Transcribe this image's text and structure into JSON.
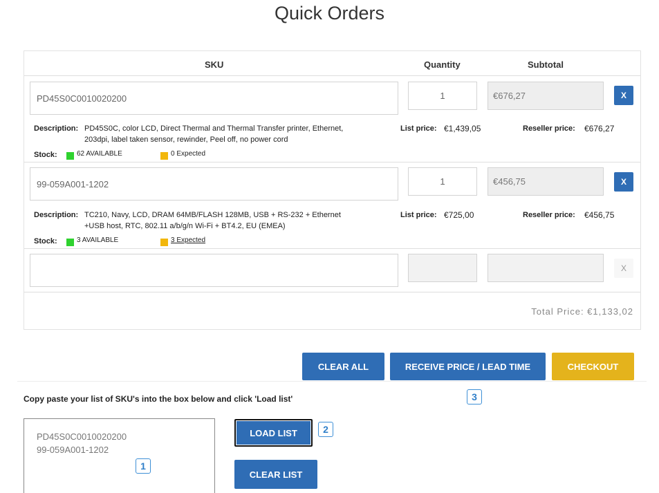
{
  "page": {
    "title": "Quick Orders"
  },
  "table": {
    "headers": {
      "sku": "SKU",
      "quantity": "Quantity",
      "subtotal": "Subtotal"
    },
    "rows": [
      {
        "sku": "PD45S0C0010020200",
        "quantity": "1",
        "subtotal": "€676,27",
        "remove": "X",
        "description_label": "Description:",
        "description_line1": "PD45S0C, color LCD, Direct Thermal and Thermal Transfer printer, Ethernet,",
        "description_line2": "203dpi, label taken sensor, rewinder, Peel off, no power cord",
        "list_price_label": "List price:",
        "list_price": "€1,439,05",
        "reseller_price_label": "Reseller price:",
        "reseller_price": "€676,27",
        "stock_label": "Stock:",
        "available": "62 AVAILABLE",
        "expected": "0 Expected"
      },
      {
        "sku": "99-059A001-1202",
        "quantity": "1",
        "subtotal": "€456,75",
        "remove": "X",
        "description_label": "Description:",
        "description_line1": "TC210, Navy, LCD, DRAM 64MB/FLASH 128MB, USB + RS-232 + Ethernet",
        "description_line2": "+USB host, RTC, 802.11 a/b/g/n Wi-Fi + BT4.2, EU (EMEA)",
        "list_price_label": "List price:",
        "list_price": "€725,00",
        "reseller_price_label": "Reseller price:",
        "reseller_price": "€456,75",
        "stock_label": "Stock:",
        "available": "3 AVAILABLE",
        "expected": "3 Expected"
      }
    ],
    "empty_row": {
      "sku": "",
      "quantity": "",
      "subtotal": "",
      "remove": "X"
    },
    "total": "Total Price: €1,133,02"
  },
  "actions": {
    "clear_all": "CLEAR ALL",
    "receive_price": "RECEIVE PRICE / LEAD TIME",
    "checkout": "CHECKOUT"
  },
  "bulk": {
    "instruction": "Copy paste your list of SKU's into the box below and click 'Load list'",
    "textarea_line1": "PD45S0C0010020200",
    "textarea_line2": "99-059A001-1202",
    "load_list": "LOAD LIST",
    "clear_list": "CLEAR LIST"
  },
  "badges": {
    "one": "1",
    "two": "2",
    "three": "3"
  },
  "colors": {
    "primary_blue": "#2f6db5",
    "checkout_yellow": "#e4b31c",
    "available_green": "#2fd22f",
    "expected_amber": "#f2b70c",
    "badge_blue": "#3d8fd6"
  }
}
